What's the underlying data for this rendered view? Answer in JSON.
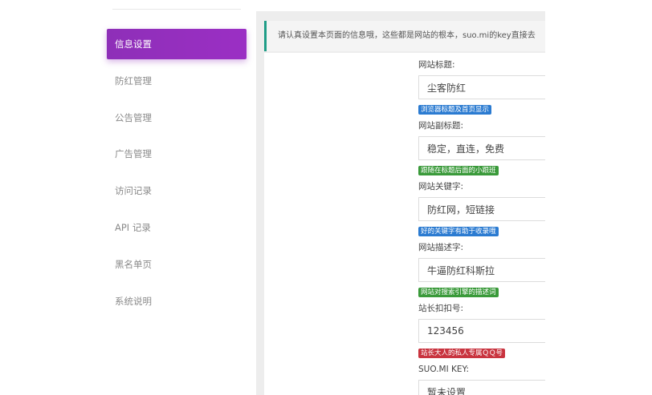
{
  "sidebar": {
    "items": [
      {
        "label": "信息设置",
        "active": true
      },
      {
        "label": "防红管理",
        "active": false
      },
      {
        "label": "公告管理",
        "active": false
      },
      {
        "label": "广告管理",
        "active": false
      },
      {
        "label": "访问记录",
        "active": false
      },
      {
        "label": "API 记录",
        "active": false
      },
      {
        "label": "黑名单页",
        "active": false
      },
      {
        "label": "系统说明",
        "active": false
      }
    ]
  },
  "notice": {
    "text": "请认真设置本页面的信息哦，这些都是网站的根本，suo.mi的key直接去"
  },
  "form": {
    "fields": [
      {
        "label": "网站标题:",
        "value": "尘客防红",
        "hint": "浏览器标题及首页显示",
        "hint_color": "#2b7bd1"
      },
      {
        "label": "网站副标题:",
        "value": "稳定，直连，免费",
        "hint": "跟随在标题后面的小跟班",
        "hint_color": "#3a9a3a"
      },
      {
        "label": "网站关键字:",
        "value": "防红网，短链接",
        "hint": "好的关键字有助于收录哦",
        "hint_color": "#2b7bd1"
      },
      {
        "label": "网站描述字:",
        "value": "牛逼防红科斯拉",
        "hint": "网站对搜索引擎的描述词",
        "hint_color": "#3a9a3a"
      },
      {
        "label": "站长扣扣号:",
        "value": "123456",
        "hint": "站长大人的私人专属ＱＱ号",
        "hint_color": "#c9343f"
      },
      {
        "label": "SUO.MI KEY:",
        "value": "暂未设置",
        "hint": "",
        "hint_color": ""
      }
    ]
  },
  "colors": {
    "active_nav": "#8e2fb8",
    "notice_border": "#1f9d87"
  }
}
